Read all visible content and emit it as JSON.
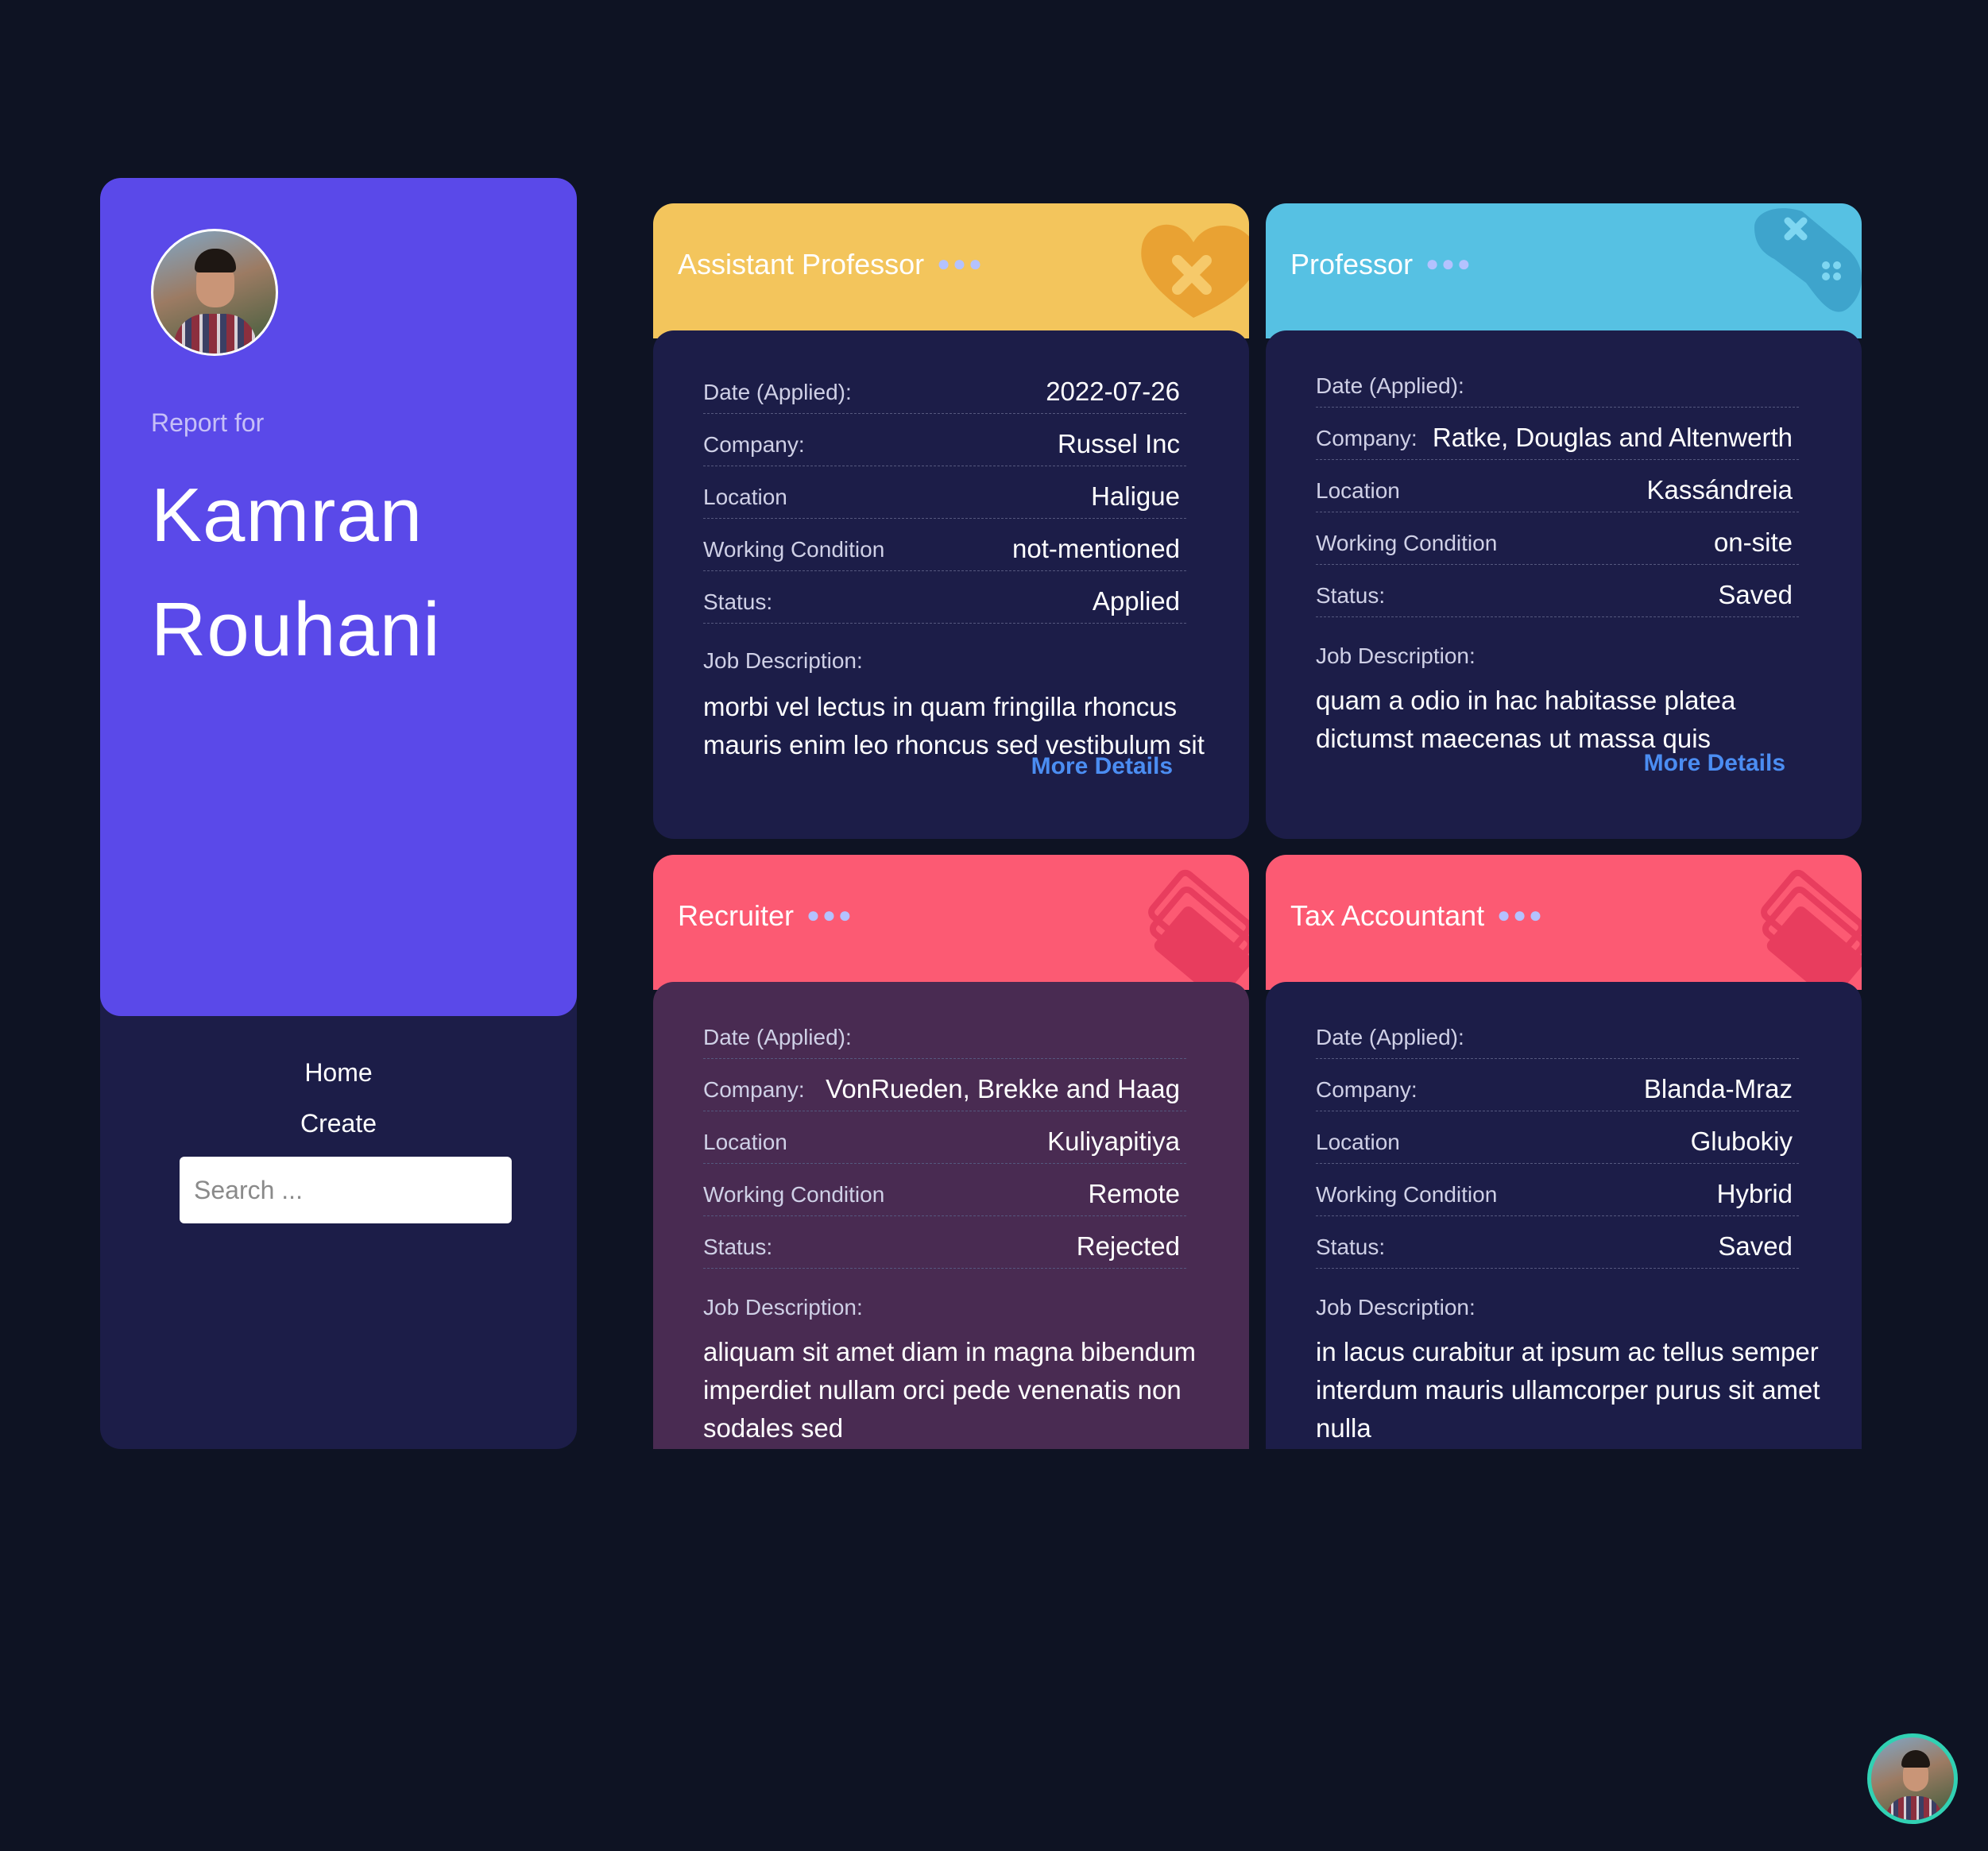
{
  "sidebar": {
    "report_for": "Report for",
    "first_name": "Kamran",
    "last_name": "Rouhani",
    "nav": [
      "Home",
      "Create"
    ],
    "search_placeholder": "Search ..."
  },
  "labels": {
    "date": "Date (Applied):",
    "company": "Company:",
    "location": "Location",
    "working_condition": "Working Condition",
    "status": "Status:",
    "job_description": "Job Description:",
    "more_details": "More Details"
  },
  "cards": [
    {
      "title": "Assistant Professor",
      "color": "#f3c55c",
      "icon": "heart-x-icon",
      "date": "2022-07-26",
      "company": "Russel Inc",
      "location": "Haligue",
      "working_condition": "not-mentioned",
      "status": "Applied",
      "description": "morbi vel lectus in quam fringilla rhoncus mauris enim leo rhoncus sed vestibulum sit"
    },
    {
      "title": "Professor",
      "color": "#56c1e3",
      "icon": "gamepad-icon",
      "date": "",
      "company": "Ratke, Douglas and Altenwerth",
      "location": "Kassándreia",
      "working_condition": "on-site",
      "status": "Saved",
      "description": "quam a odio in hac habitasse platea dictumst maecenas ut massa quis"
    },
    {
      "title": "Recruiter",
      "color": "#fc5a73",
      "icon": "tickets-icon",
      "date": "",
      "company": "VonRueden, Brekke and Haag",
      "location": "Kuliyapitiya",
      "working_condition": "Remote",
      "status": "Rejected",
      "description": "aliquam sit amet diam in magna bibendum imperdiet nullam orci pede venenatis non sodales sed"
    },
    {
      "title": "Tax Accountant",
      "color": "#fc5a73",
      "icon": "tickets-icon",
      "date": "",
      "company": "Blanda-Mraz",
      "location": "Glubokiy",
      "working_condition": "Hybrid",
      "status": "Saved",
      "description": "in lacus curabitur at ipsum ac tellus semper interdum mauris ullamcorper purus sit amet nulla"
    }
  ],
  "colors": {
    "background": "#0e1323",
    "sidebar": "#1c1d48",
    "profile": "#5a49e9",
    "card_body": "#1c1d48",
    "card_body_rejected": "#492b52",
    "link": "#4b8df2",
    "avatar_ring": "#31d1b3"
  }
}
